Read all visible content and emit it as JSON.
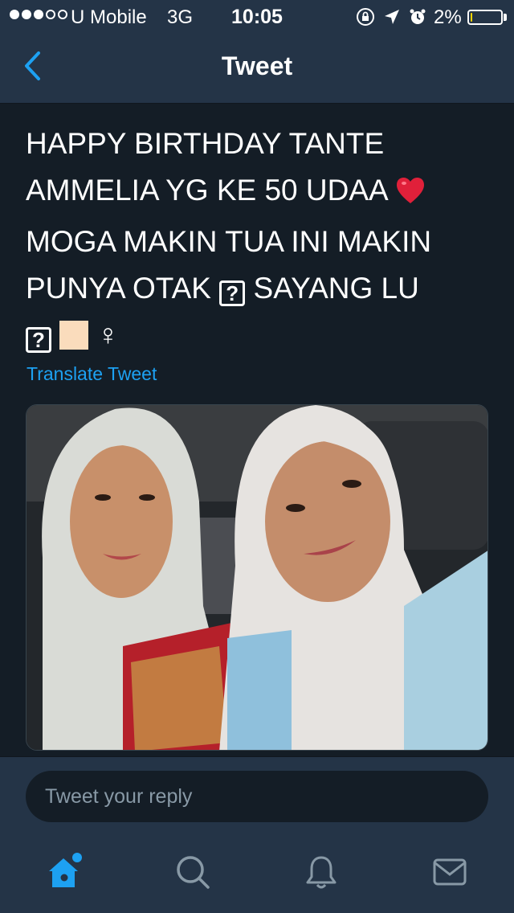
{
  "status_bar": {
    "carrier": "U Mobile",
    "network": "3G",
    "time": "10:05",
    "battery_percent": "2%",
    "battery_level": 0.05,
    "signal_strength": 3,
    "signal_max": 5,
    "icons": [
      "orientation-lock-icon",
      "location-arrow-icon",
      "alarm-icon"
    ]
  },
  "nav": {
    "title": "Tweet",
    "back_icon": "chevron-left-icon"
  },
  "tweet": {
    "line1": "HAPPY BIRTHDAY TANTE",
    "line2": "AMMELIA YG KE 50 UDAA",
    "line3": "MOGA MAKIN TUA INI MAKIN",
    "line4": "PUNYA OTAK",
    "line4b": "SAYANG LU",
    "unknown_glyph": "?",
    "female_sign": "♀",
    "translate_label": "Translate Tweet",
    "media": "photo"
  },
  "reply": {
    "placeholder": "Tweet your reply"
  },
  "tabs": [
    {
      "name": "home",
      "icon": "home-icon",
      "active": true
    },
    {
      "name": "search",
      "icon": "search-icon",
      "active": false
    },
    {
      "name": "notifications",
      "icon": "bell-icon",
      "active": false
    },
    {
      "name": "messages",
      "icon": "envelope-icon",
      "active": false
    }
  ],
  "colors": {
    "background": "#141d26",
    "bars": "#243447",
    "accent": "#1da1f2",
    "muted": "#8899a6"
  }
}
